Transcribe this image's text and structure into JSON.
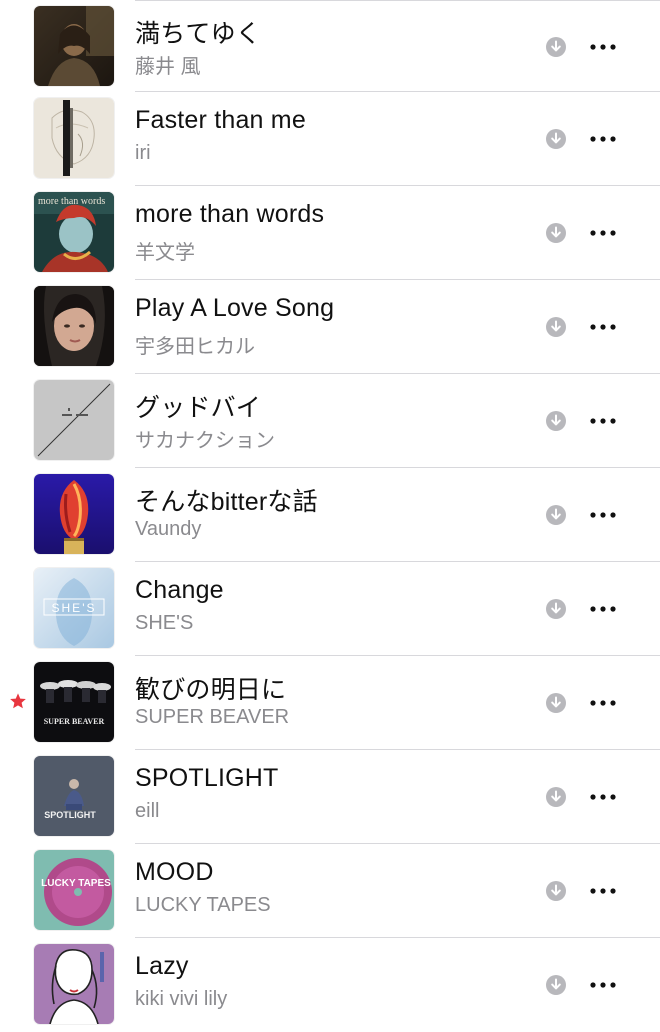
{
  "songs": [
    {
      "title": "満ちてゆく",
      "artist": "藤井 風"
    },
    {
      "title": "Faster than me",
      "artist": "iri"
    },
    {
      "title": "more than words",
      "artist": "羊文学",
      "art_text": "more than words"
    },
    {
      "title": "Play A Love Song",
      "artist": "宇多田ヒカル"
    },
    {
      "title": "グッドバイ",
      "artist": "サカナクション"
    },
    {
      "title": "そんなbitterな話",
      "artist": "Vaundy"
    },
    {
      "title": "Change",
      "artist": "SHE'S",
      "art_text": "SHE'S"
    },
    {
      "title": "歓びの明日に",
      "artist": "SUPER BEAVER",
      "art_text": "SUPER BEAVER",
      "starred": true
    },
    {
      "title": "SPOTLIGHT",
      "artist": "eill",
      "art_text": "SPOTLIGHT"
    },
    {
      "title": "MOOD",
      "artist": "LUCKY TAPES",
      "art_text": "LUCKY TAPES"
    },
    {
      "title": "Lazy",
      "artist": "kiki vivi lily"
    }
  ],
  "icons": {
    "download": "download-circle-icon",
    "more": "more-ellipsis-icon",
    "star": "star-icon"
  },
  "colors": {
    "star": "#e8363f",
    "icon_gray": "#b8b8bc",
    "more": "#111111"
  }
}
